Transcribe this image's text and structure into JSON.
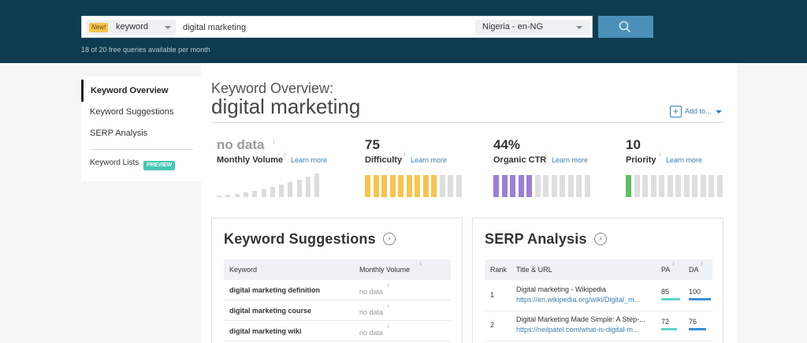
{
  "search": {
    "new_badge": "New!",
    "type_value": "keyword",
    "query_value": "digital marketing",
    "locale_value": "Nigeria - en-NG",
    "quota_text": "18 of 20 free queries available per month"
  },
  "sidebar": {
    "items": [
      {
        "label": "Keyword Overview"
      },
      {
        "label": "Keyword Suggestions"
      },
      {
        "label": "SERP Analysis"
      }
    ],
    "lists_label": "Keyword Lists",
    "preview_badge": "PREVIEW"
  },
  "overview": {
    "heading": "Keyword Overview:",
    "query": "digital marketing",
    "add_to_label": "Add to...",
    "info_glyph": "i",
    "learn_more": "Learn more",
    "metrics": [
      {
        "value": "no data",
        "label": "Monthly Volume",
        "level": null
      },
      {
        "value": "75",
        "label": "Difficulty",
        "level": 0.75,
        "color": "#f6c44f"
      },
      {
        "value": "44%",
        "label": "Organic CTR",
        "level": 0.44,
        "color": "#9b7fd6"
      },
      {
        "value": "10",
        "label": "Priority",
        "level": 0.1,
        "color": "#5cc15c"
      }
    ]
  },
  "suggestions": {
    "title": "Keyword Suggestions",
    "col_keyword": "Keyword",
    "col_volume": "Monthly Volume",
    "rows": [
      {
        "keyword": "digital marketing definition",
        "volume": "no data"
      },
      {
        "keyword": "digital marketing course",
        "volume": "no data"
      },
      {
        "keyword": "digital marketing wiki",
        "volume": "no data"
      }
    ]
  },
  "serp": {
    "title": "SERP Analysis",
    "col_rank": "Rank",
    "col_title": "Title & URL",
    "col_pa": "PA",
    "col_da": "DA",
    "rows": [
      {
        "rank": "1",
        "title": "Digital marketing - Wikipedia",
        "url": "https://en.wikipedia.org/wiki/Digital_m...",
        "pa": "85",
        "da": "100"
      },
      {
        "rank": "2",
        "title": "Digital Marketing Made Simple: A Step-...",
        "url": "https://neilpatel.com/what-is-digital-m...",
        "pa": "72",
        "da": "76"
      }
    ]
  }
}
